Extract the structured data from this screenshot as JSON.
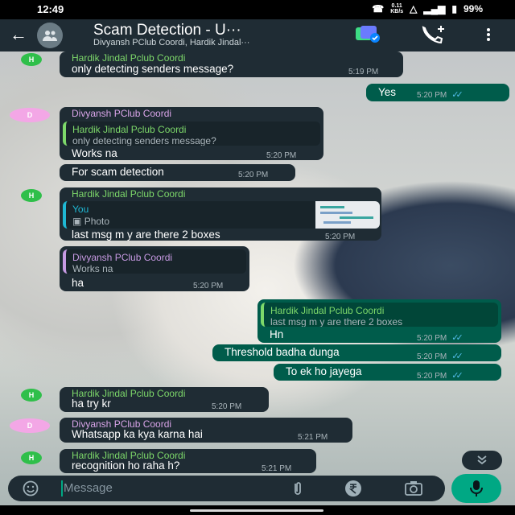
{
  "status_bar": {
    "time": "12:49",
    "net_speed_value": "0.11",
    "net_speed_unit": "KB/s",
    "battery": "99%"
  },
  "header": {
    "title": "Scam Detection - U···",
    "subtitle": "Divyansh PClub Coordi, Hardik Jindal···"
  },
  "messages": [
    {
      "id": "m1",
      "sender": "Hardik Jindal Pclub Coordi",
      "avatar": "H",
      "text": "only detecting senders message?",
      "time": "5:19 PM"
    },
    {
      "id": "m2",
      "text": "Yes",
      "time": "5:20 PM"
    },
    {
      "id": "m3",
      "sender": "Divyansh PClub Coordi",
      "avatar": "D",
      "quote_sender": "Hardik Jindal Pclub Coordi",
      "quote_text": "only detecting senders message?",
      "text": "Works na",
      "time": "5:20 PM"
    },
    {
      "id": "m4",
      "text": "For scam detection",
      "time": "5:20 PM"
    },
    {
      "id": "m5",
      "sender": "Hardik Jindal Pclub Coordi",
      "avatar": "H",
      "quote_sender": "You",
      "quote_text": "Photo",
      "text": "last msg m y are there 2 boxes",
      "time": "5:20 PM"
    },
    {
      "id": "m6",
      "quote_sender": "Divyansh PClub Coordi",
      "quote_text": "Works na",
      "text": "ha",
      "time": "5:20 PM"
    },
    {
      "id": "m7",
      "quote_sender": "Hardik Jindal Pclub Coordi",
      "quote_text": "last msg m y are there 2 boxes",
      "text": "Hn",
      "time": "5:20 PM"
    },
    {
      "id": "m8",
      "text": "Threshold badha dunga",
      "time": "5:20 PM"
    },
    {
      "id": "m9",
      "text": "To ek ho jayega",
      "time": "5:20 PM"
    },
    {
      "id": "m10",
      "sender": "Hardik Jindal Pclub Coordi",
      "avatar": "H",
      "text": "ha try kr",
      "time": "5:20 PM"
    },
    {
      "id": "m11",
      "sender": "Divyansh PClub Coordi",
      "avatar": "D",
      "text": "Whatsapp ka kya karna hai",
      "time": "5:21 PM"
    },
    {
      "id": "m12",
      "sender": "Hardik Jindal Pclub Coordi",
      "avatar": "H",
      "text": "recognition ho raha h?",
      "time": "5:21 PM"
    }
  ],
  "composer": {
    "placeholder": "Message"
  },
  "icons": [
    "back-arrow-icon",
    "group-avatar-icon",
    "meta-ai-icon",
    "add-call-icon",
    "more-options-icon",
    "emoji-icon",
    "attach-icon",
    "rupee-icon",
    "camera-icon",
    "mic-icon",
    "scroll-down-icon"
  ],
  "colors": {
    "header": "#1f2c34",
    "incoming": "#1f2c34",
    "outgoing": "#005c4b",
    "accent": "#00a884",
    "tick": "#53bdeb"
  }
}
